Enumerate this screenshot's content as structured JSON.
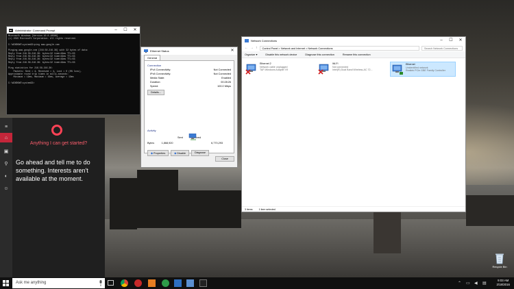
{
  "cmd": {
    "title": "Administrator: Command Prompt",
    "lines": [
      "Microsoft Windows [Version 10.0.10586]",
      "(c) 2015 Microsoft Corporation. All rights reserved.",
      "",
      "C:\\WINDOWS\\system32>ping www.google.com",
      "",
      "Pinging www.google.com [216.58.216.36] with 32 bytes of data:",
      "Reply from 216.58.216.36: bytes=32 time=19ms TTL=53",
      "Reply from 216.58.216.36: bytes=32 time=19ms TTL=53",
      "Reply from 216.58.216.36: bytes=32 time=19ms TTL=53",
      "Reply from 216.58.216.36: bytes=32 time=19ms TTL=53",
      "",
      "Ping statistics for 216.58.216.36:",
      "    Packets: Sent = 4, Received = 4, Lost = 0 (0% loss),",
      "Approximate round trip times in milli-seconds:",
      "    Minimum = 19ms, Maximum = 19ms, Average = 19ms",
      "",
      "C:\\WINDOWS\\system32>"
    ]
  },
  "ethernet_status": {
    "title": "Ethernet Status",
    "tab": "General",
    "connection_heading": "Connection",
    "rows": [
      {
        "label": "IPv4 Connectivity:",
        "value": "Not Connected"
      },
      {
        "label": "IPv6 Connectivity:",
        "value": "Not Connected"
      },
      {
        "label": "Media State:",
        "value": "Enabled"
      },
      {
        "label": "Duration:",
        "value": "00:28:26"
      },
      {
        "label": "Speed:",
        "value": "100.0 Mbps"
      }
    ],
    "details_button": "Details...",
    "activity_heading": "Activity",
    "sent_label": "Sent",
    "received_label": "Received",
    "bytes_label": "Bytes:",
    "bytes_sent": "1,868,920",
    "bytes_received": "6,770,293",
    "properties_button": "Properties",
    "disable_button": "Disable",
    "diagnose_button": "Diagnose",
    "close_button": "Close"
  },
  "network_connections": {
    "title": "Network Connections",
    "breadcrumb": "Control Panel  >  Network and Internet  >  Network Connections",
    "search_placeholder": "Search Network Connections",
    "toolbar": {
      "organize": "Organize",
      "disable": "Disable this network device",
      "diagnose": "Diagnose this connection",
      "rename": "Rename this connection"
    },
    "items": [
      {
        "name": "Ethernet 2",
        "status": "Network cable unplugged",
        "device": "TAP-Windows Adapter V9",
        "selected": false,
        "error": true
      },
      {
        "name": "Wi-Fi",
        "status": "Not connected",
        "device": "Intel(R) Dual Band Wireless-AC 72...",
        "selected": false,
        "error": true
      },
      {
        "name": "Ethernet",
        "status": "Unidentified network",
        "device": "Realtek PCIe GBE Family Controller",
        "selected": true,
        "error": false
      }
    ],
    "status_items": "3 items",
    "status_selected": "1 item selected"
  },
  "cortana": {
    "prompt": "Anything I can get started?",
    "message": "Go ahead and tell me to do something. Interests aren't available at the moment."
  },
  "taskbar": {
    "search_placeholder": "Ask me anything",
    "time": "9:03 AM",
    "date": "2/18/2016"
  },
  "desktop": {
    "recycle_bin_label": "Recycle Bin"
  }
}
